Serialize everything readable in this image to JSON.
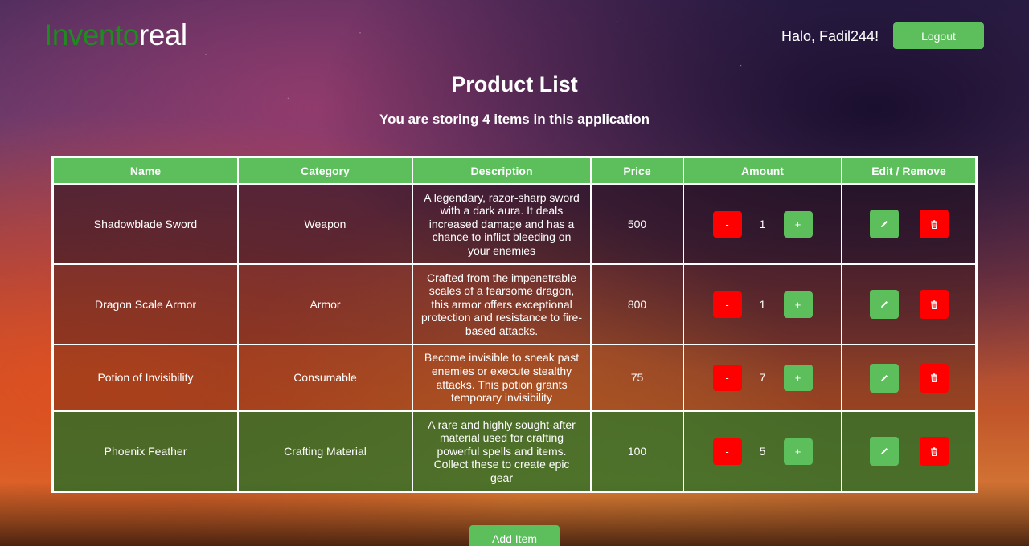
{
  "header": {
    "logo_part1": "Invento",
    "logo_part2": "real",
    "greeting": "Halo, Fadil244!",
    "logout_label": "Logout"
  },
  "main": {
    "title": "Product List",
    "subtitle": "You are storing 4 items in this application",
    "add_item_label": "Add Item"
  },
  "table": {
    "headers": [
      "Name",
      "Category",
      "Description",
      "Price",
      "Amount",
      "Edit / Remove"
    ],
    "rows": [
      {
        "name": "Shadowblade Sword",
        "category": "Weapon",
        "description": "A legendary, razor-sharp sword with a dark aura. It deals increased damage and has a chance to inflict bleeding on your enemies",
        "price": "500",
        "amount": "1"
      },
      {
        "name": "Dragon Scale Armor",
        "category": "Armor",
        "description": "Crafted from the impenetrable scales of a fearsome dragon, this armor offers exceptional protection and resistance to fire-based attacks.",
        "price": "800",
        "amount": "1"
      },
      {
        "name": "Potion of Invisibility",
        "category": "Consumable",
        "description": "Become invisible to sneak past enemies or execute stealthy attacks. This potion grants temporary invisibility",
        "price": "75",
        "amount": "7"
      },
      {
        "name": "Phoenix Feather",
        "category": "Crafting Material",
        "description": "A rare and highly sought-after material used for crafting powerful spells and items. Collect these to create epic gear",
        "price": "100",
        "amount": "5"
      }
    ],
    "minus_label": "-",
    "plus_label": "+"
  },
  "icons": {
    "edit": "pencil-icon",
    "delete": "trash-icon"
  },
  "colors": {
    "accent_green": "#5cbf5c",
    "logo_green": "#1f8a1f",
    "danger_red": "#ff0000"
  }
}
